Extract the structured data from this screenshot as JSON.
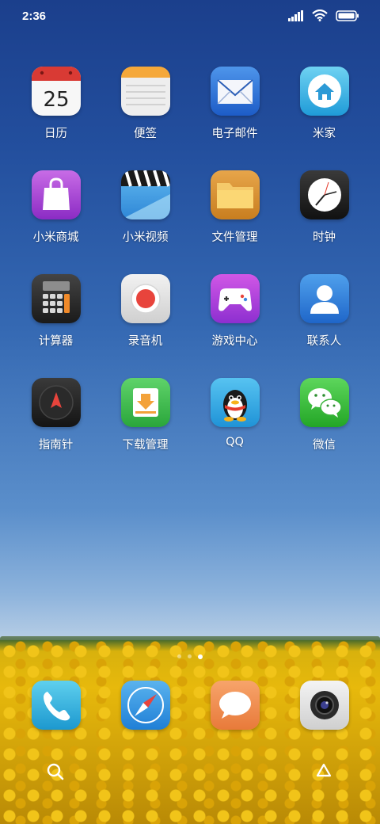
{
  "status": {
    "time": "2:36",
    "signal_icon": "signal-icon",
    "wifi_icon": "wifi-icon",
    "battery_icon": "battery-icon"
  },
  "apps": [
    {
      "label": "日历",
      "icon": "calendar-icon",
      "day": "25"
    },
    {
      "label": "便签",
      "icon": "notes-icon"
    },
    {
      "label": "电子邮件",
      "icon": "mail-icon"
    },
    {
      "label": "米家",
      "icon": "home-icon"
    },
    {
      "label": "小米商城",
      "icon": "shopping-bag-icon"
    },
    {
      "label": "小米视频",
      "icon": "video-clapper-icon"
    },
    {
      "label": "文件管理",
      "icon": "folder-icon"
    },
    {
      "label": "时钟",
      "icon": "clock-icon"
    },
    {
      "label": "计算器",
      "icon": "calculator-icon"
    },
    {
      "label": "录音机",
      "icon": "recorder-icon"
    },
    {
      "label": "游戏中心",
      "icon": "gamepad-icon"
    },
    {
      "label": "联系人",
      "icon": "contacts-icon"
    },
    {
      "label": "指南针",
      "icon": "compass-icon"
    },
    {
      "label": "下载管理",
      "icon": "download-icon"
    },
    {
      "label": "QQ",
      "icon": "qq-penguin-icon"
    },
    {
      "label": "微信",
      "icon": "wechat-icon"
    }
  ],
  "dock": [
    {
      "icon": "phone-icon"
    },
    {
      "icon": "browser-compass-icon"
    },
    {
      "icon": "messages-icon"
    },
    {
      "icon": "camera-icon"
    }
  ],
  "page_indicator": {
    "count": 3,
    "active": 3
  },
  "bottom": {
    "left_icon": "search-icon",
    "right_icon": "recycle-icon"
  }
}
